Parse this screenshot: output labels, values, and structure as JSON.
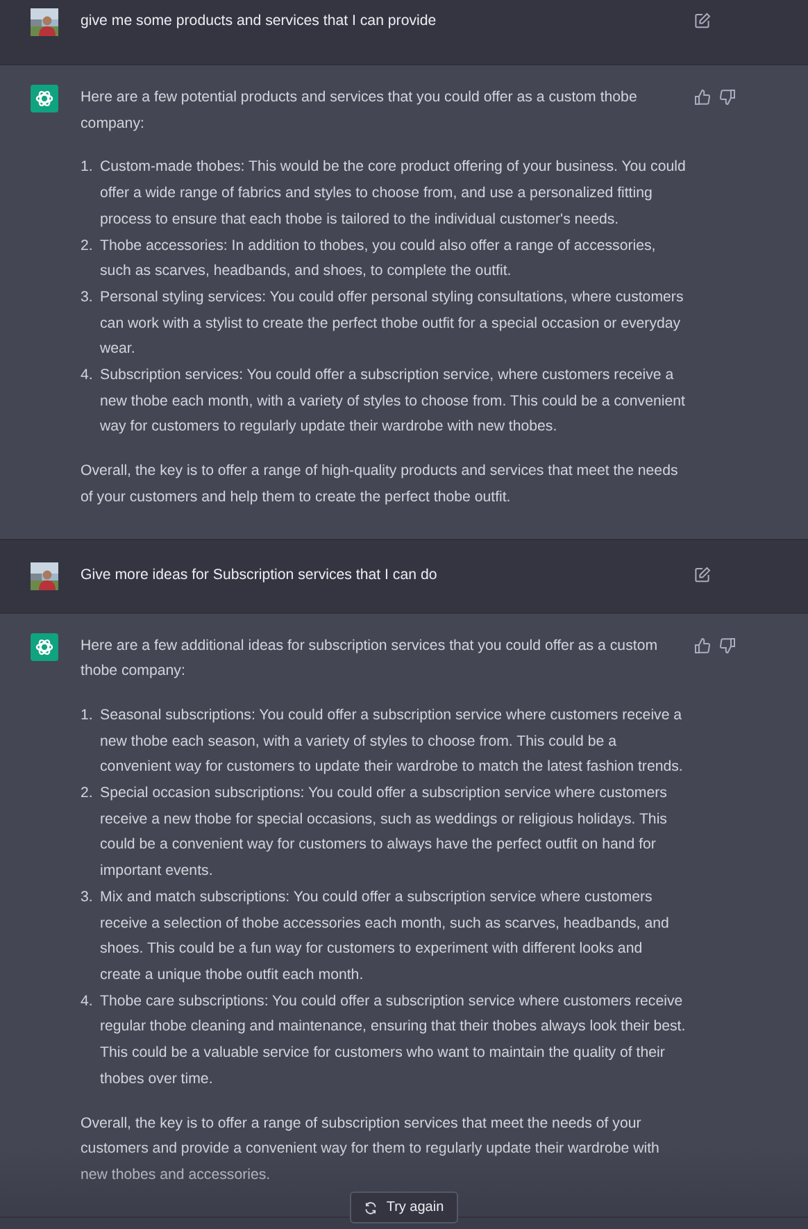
{
  "messages": [
    {
      "kind": "user",
      "text": "give me some products and services that I can provide"
    },
    {
      "kind": "assistant",
      "intro": "Here are a few potential products and services that you could offer as a custom thobe company:",
      "items": [
        {
          "number": "1.",
          "text": "Custom-made thobes: This would be the core product offering of your business. You could offer a wide range of fabrics and styles to choose from, and use a personalized fitting process to ensure that each thobe is tailored to the individual customer's needs."
        },
        {
          "number": "2.",
          "text": "Thobe accessories: In addition to thobes, you could also offer a range of accessories, such as scarves, headbands, and shoes, to complete the outfit."
        },
        {
          "number": "3.",
          "text": "Personal styling services: You could offer personal styling consultations, where customers can work with a stylist to create the perfect thobe outfit for a special occasion or everyday wear."
        },
        {
          "number": "4.",
          "text": "Subscription services: You could offer a subscription service, where customers receive a new thobe each month, with a variety of styles to choose from. This could be a convenient way for customers to regularly update their wardrobe with new thobes."
        }
      ],
      "outro": "Overall, the key is to offer a range of high-quality products and services that meet the needs of your customers and help them to create the perfect thobe outfit."
    },
    {
      "kind": "user",
      "text": "Give more ideas for Subscription services that I can do"
    },
    {
      "kind": "assistant",
      "intro": "Here are a few additional ideas for subscription services that you could offer as a custom thobe company:",
      "items": [
        {
          "number": "1.",
          "text": "Seasonal subscriptions: You could offer a subscription service where customers receive a new thobe each season, with a variety of styles to choose from. This could be a convenient way for customers to update their wardrobe to match the latest fashion trends."
        },
        {
          "number": "2.",
          "text": "Special occasion subscriptions: You could offer a subscription service where customers receive a new thobe for special occasions, such as weddings or religious holidays. This could be a convenient way for customers to always have the perfect outfit on hand for important events."
        },
        {
          "number": "3.",
          "text": "Mix and match subscriptions: You could offer a subscription service where customers receive a selection of thobe accessories each month, such as scarves, headbands, and shoes. This could be a fun way for customers to experiment with different looks and create a unique thobe outfit each month."
        },
        {
          "number": "4.",
          "text": "Thobe care subscriptions: You could offer a subscription service where customers receive regular thobe cleaning and maintenance, ensuring that their thobes always look their best. This could be a valuable service for customers who want to maintain the quality of their thobes over time."
        }
      ],
      "outro": "Overall, the key is to offer a range of subscription services that meet the needs of your customers and provide a convenient way for them to regularly update their wardrobe with new thobes and accessories."
    }
  ],
  "retry_button": {
    "label": "Try again"
  }
}
